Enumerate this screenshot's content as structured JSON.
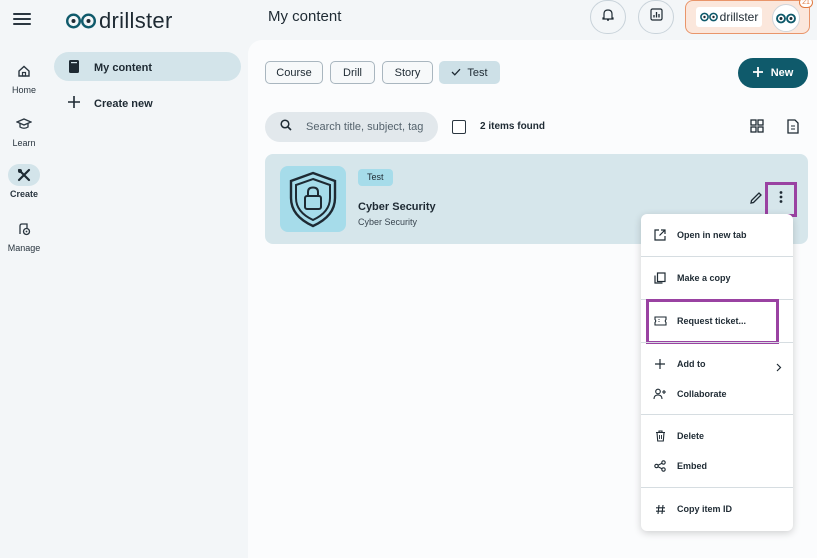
{
  "rail": {
    "items": [
      {
        "label": "Home",
        "icon": "home-icon"
      },
      {
        "label": "Learn",
        "icon": "graduation-cap-icon"
      },
      {
        "label": "Create",
        "icon": "tools-icon",
        "active": true
      },
      {
        "label": "Manage",
        "icon": "manage-settings-icon"
      }
    ]
  },
  "brand": {
    "name": "drillster",
    "accent": "#0f5a6b"
  },
  "sidebar": {
    "items": [
      {
        "label": "My content",
        "icon": "book-icon",
        "active": true
      },
      {
        "label": "Create new",
        "icon": "plus-icon"
      }
    ]
  },
  "header": {
    "title": "My content",
    "notifications_icon": "bell-icon",
    "stats_icon": "chart-icon",
    "org": {
      "name": "drillster",
      "badge": "21"
    }
  },
  "filters": {
    "chips": [
      {
        "label": "Course",
        "selected": false
      },
      {
        "label": "Drill",
        "selected": false
      },
      {
        "label": "Story",
        "selected": false
      },
      {
        "label": "Test",
        "selected": true
      }
    ],
    "new_label": "New"
  },
  "search": {
    "placeholder": "Search title, subject, tag",
    "value": "",
    "found_text": "2 items found"
  },
  "card": {
    "tag": "Test",
    "title": "Cyber Security",
    "subtitle": "Cyber Security",
    "thumb_icon": "shield-lock-icon"
  },
  "menu": {
    "items": [
      {
        "label": "Open in new tab",
        "icon": "open-external-icon"
      },
      {
        "label": "Make a copy",
        "icon": "copy-icon"
      },
      {
        "label": "Request ticket...",
        "icon": "ticket-icon"
      },
      {
        "label": "Add to",
        "icon": "plus-icon"
      },
      {
        "label": "Collaborate",
        "icon": "add-person-icon"
      },
      {
        "label": "Delete",
        "icon": "trash-icon"
      },
      {
        "label": "Embed",
        "icon": "share-icon"
      },
      {
        "label": "Copy item ID",
        "icon": "hash-icon"
      }
    ]
  },
  "colors": {
    "highlight": "#9a42a2",
    "primary": "#0f5a6b",
    "chip_selected": "#cde0e7",
    "card": "#d6e6eb"
  }
}
